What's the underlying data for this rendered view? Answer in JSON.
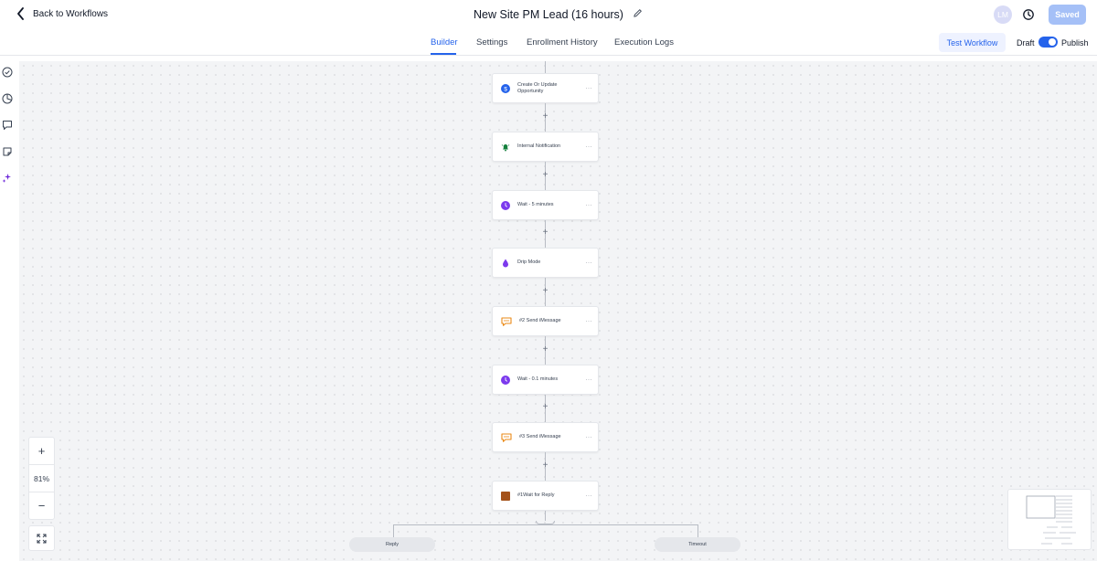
{
  "header": {
    "back_label": "Back to Workflows",
    "title": "New Site PM Lead (16 hours)",
    "avatar_initials": "LM",
    "saved_label": "Saved"
  },
  "tabs": [
    {
      "label": "Builder",
      "active": true
    },
    {
      "label": "Settings",
      "active": false
    },
    {
      "label": "Enrollment History",
      "active": false
    },
    {
      "label": "Execution Logs",
      "active": false
    }
  ],
  "actions": {
    "test_label": "Test Workflow",
    "draft_label": "Draft",
    "publish_label": "Publish",
    "published": true
  },
  "rail_icons": [
    "check-circle-icon",
    "pie-chart-icon",
    "comment-icon",
    "note-icon",
    "sparkles-icon"
  ],
  "nodes": [
    {
      "label": "Create Or Update Opportunity",
      "icon": "dollar-icon",
      "color": "#2563eb"
    },
    {
      "label": "Internal Notification",
      "icon": "bell-icon",
      "color": "#15803d"
    },
    {
      "label": "Wait - 5 minutes",
      "icon": "clock-icon",
      "color": "#7c3aed"
    },
    {
      "label": "Drip Mode",
      "icon": "drop-icon",
      "color": "#7c3aed"
    },
    {
      "label": "#2 Send iMessage",
      "icon": "chat-bubble-icon",
      "color": "#ea8a17"
    },
    {
      "label": "Wait - 0.1 minutes",
      "icon": "clock-icon",
      "color": "#7c3aed"
    },
    {
      "label": "#3 Send iMessage",
      "icon": "chat-bubble-icon",
      "color": "#ea8a17"
    },
    {
      "label": "#1Wait for Reply",
      "icon": "reply-wait-icon",
      "color": "#a4521a"
    }
  ],
  "branches": [
    {
      "label": "Reply"
    },
    {
      "label": "Timeout"
    }
  ],
  "zoom": {
    "level": "81%",
    "plus": "+",
    "minus": "−"
  },
  "colors": {
    "accent": "#2563eb",
    "saved_bg": "#a5c0f7",
    "canvas_bg": "#f3f4f6"
  }
}
